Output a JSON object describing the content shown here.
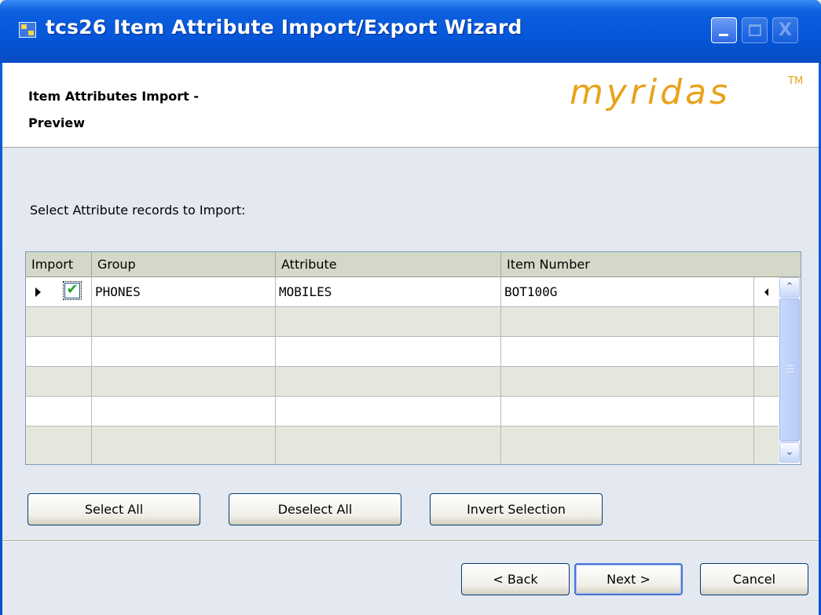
{
  "window": {
    "title": "tcs26 Item Attribute Import/Export Wizard",
    "close_glyph": "X"
  },
  "header": {
    "title_line1": "Item Attributes Import -",
    "title_line2": "Preview",
    "logo_text": "myridas",
    "logo_tm": "TM",
    "logo_color": "#e9a21a"
  },
  "prompt": "Select Attribute records to Import:",
  "grid": {
    "columns": [
      "Import",
      "Group",
      "Attribute",
      "Item Number"
    ],
    "rows": [
      {
        "import_checked": true,
        "group": "PHONES",
        "attribute": "MOBILES",
        "item_number": "BOT100G"
      }
    ]
  },
  "selection_buttons": {
    "select_all": "Select All",
    "deselect_all": "Deselect All",
    "invert_selection": "Invert Selection"
  },
  "nav_buttons": {
    "back": "< Back",
    "next": "Next >",
    "cancel": "Cancel"
  },
  "icons": {
    "checkmark": "✔",
    "scroll_up": "⌃",
    "scroll_down": "⌄"
  }
}
